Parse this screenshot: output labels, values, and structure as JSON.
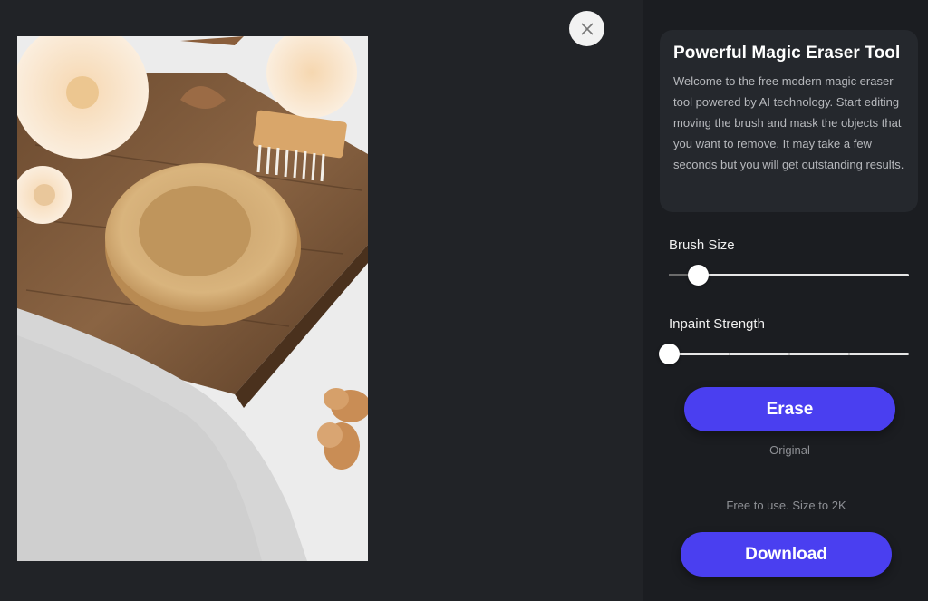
{
  "viewer": {
    "close_icon": "close-icon",
    "image_description_alt": "wooden bowl on board with dried flowers, brush, acorns and towel"
  },
  "panel": {
    "title": "Powerful Magic Eraser Tool",
    "description": "Welcome to the free modern magic eraser tool powered by AI technology. Start editing moving the brush and mask the objects that you want to remove. It may take a few seconds but you will get outstanding results."
  },
  "controls": {
    "brush_size": {
      "label": "Brush Size",
      "value": 0.12
    },
    "inpaint_strength": {
      "label": "Inpaint Strength",
      "value": 0.0
    },
    "erase_label": "Erase",
    "original_label": "Original",
    "free_note": "Free to use. Size to 2K",
    "download_label": "Download"
  },
  "colors": {
    "accent": "#4a3ff0",
    "background": "#202227",
    "panel": "#1b1d21",
    "card": "#25282d"
  }
}
